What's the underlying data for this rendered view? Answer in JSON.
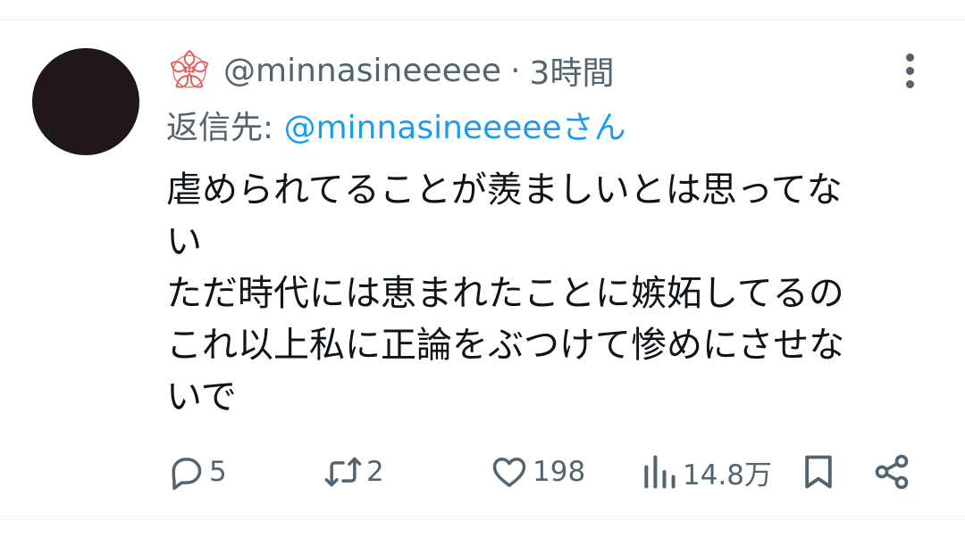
{
  "tweet": {
    "handle": "@minnasineeeee",
    "separator": "·",
    "time": "3時間",
    "reply_prefix": "返信先: ",
    "reply_to": "@minnasineeeee",
    "reply_suffix": "さん",
    "lines": [
      "虐められてることが羨ましいとは思ってな",
      "い",
      "ただ時代には恵まれたことに嫉妬してるの",
      "これ以上私に正論をぶつけて惨めにさせな",
      "いで"
    ]
  },
  "actions": {
    "replies": "5",
    "retweets": "2",
    "likes": "198",
    "views": "14.8万"
  },
  "colors": {
    "text": "#0f1419",
    "muted": "#536471",
    "link": "#1d9bf0",
    "badge": "#e0625f",
    "avatar": "#1f1719"
  },
  "icons": {
    "badge": "sakura-badge-icon",
    "more": "more-vertical-icon",
    "reply": "reply-bubble-icon",
    "retweet": "retweet-icon",
    "like": "heart-icon",
    "views": "views-bar-chart-icon",
    "bookmark": "bookmark-icon",
    "share": "share-icon"
  }
}
